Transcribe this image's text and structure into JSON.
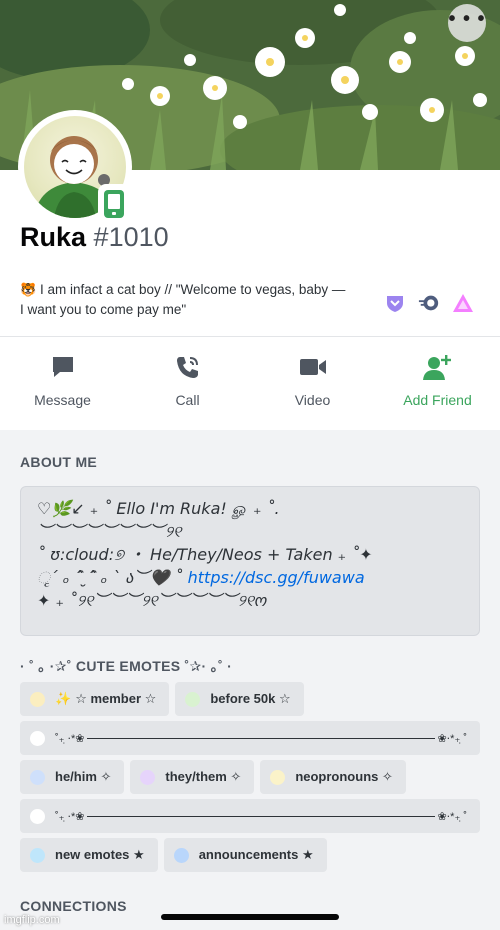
{
  "profile": {
    "username": "Ruka",
    "discriminator": "#1010",
    "bio_line1": "I am infact a cat boy // \"Welcome to vegas, baby —",
    "bio_line2": "I want you to come pay me\"",
    "bio_emoji": "🐯"
  },
  "actions": [
    {
      "label": "Message",
      "icon": "message-icon"
    },
    {
      "label": "Call",
      "icon": "call-icon"
    },
    {
      "label": "Video",
      "icon": "video-icon"
    },
    {
      "label": "Add Friend",
      "icon": "add-friend-icon"
    }
  ],
  "badges": [
    "hypesquad-badge-icon",
    "nitro-badge-icon",
    "boost-badge-icon"
  ],
  "about": {
    "title": "ABOUT ME",
    "lines": [
      "♡🌿↙︎ ₊ ˚ Ello I'm Ruka! ௐ ₊ ˚.",
      "︶︶︶︶︶︶︶︶୨୧",
      "˚ ʊ:cloud:୭ ・ He/They/Neos + Taken ₊ ˚✦",
      "ૃ´ ₒ ˆ̑ ̮ˆ̑ ₒ ` ა︶🖤 ˚",
      "✦ ₊ ˚୨୧︶︶︶୨୧︶︶︶︶︶୨୧ო"
    ],
    "link": "https://dsc.gg/fuwawa"
  },
  "emotes": {
    "title": "· ˚ ｡ ·✰˚ CUTE EMOTES ˚✰· ｡˚ ·",
    "roles": {
      "member": "☆ member ☆",
      "before50k": "before 50k ☆",
      "divider1_left": "˚₊ ̣‧*❀",
      "divider1_right": "❀‧*₊ ̣˚",
      "hehim": "he/him ✧",
      "theythem": "they/them ✧",
      "neopronouns": "neopronouns ✧",
      "divider2_left": "˚₊ ̣‧*❀",
      "divider2_right": "❀‧*₊ ̣˚",
      "newemotes": "new emotes ★",
      "announcements": "announcements ★",
      "member_emoji": "✨"
    },
    "colors": {
      "member": "#fbeec0",
      "before50k": "#d9f2d0",
      "divider": "#ffffff",
      "hehim": "#cfe0fb",
      "theythem": "#e6d4fb",
      "neopronouns": "#fbf3c9",
      "newemotes": "#bfe6fb",
      "announcements": "#b9d6fb"
    }
  },
  "connections": {
    "title": "CONNECTIONS"
  },
  "watermark": "imgflip.com",
  "accent": "#3ba55d",
  "link_color": "#0068e0"
}
